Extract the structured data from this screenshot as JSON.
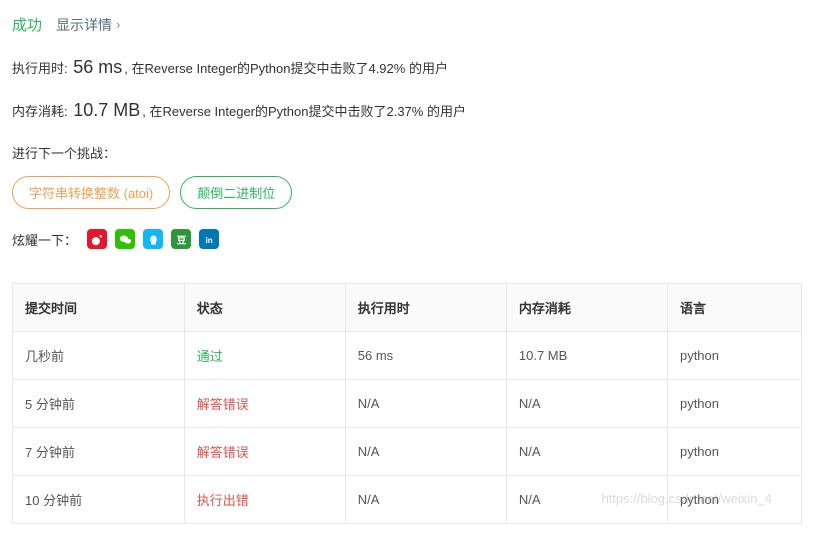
{
  "header": {
    "success": "成功",
    "show_details": "显示详情"
  },
  "runtime": {
    "label": "执行用时:",
    "value": "56 ms",
    "suffix": ", 在Reverse Integer的Python提交中击败了4.92% 的用户"
  },
  "memory": {
    "label": "内存消耗:",
    "value": "10.7 MB",
    "suffix": ", 在Reverse Integer的Python提交中击败了2.37% 的用户"
  },
  "next_challenge_label": "进行下一个挑战：",
  "challenges": {
    "atoi": "字符串转换整数 (atoi)",
    "reverse_bits": "颠倒二进制位"
  },
  "share_label": "炫耀一下：",
  "table": {
    "headers": {
      "time": "提交时间",
      "status": "状态",
      "runtime": "执行用时",
      "memory": "内存消耗",
      "lang": "语言"
    },
    "rows": [
      {
        "time": "几秒前",
        "status": "通过",
        "status_class": "status-pass",
        "runtime": "56 ms",
        "memory": "10.7 MB",
        "lang": "python"
      },
      {
        "time": "5 分钟前",
        "status": "解答错误",
        "status_class": "status-wa",
        "runtime": "N/A",
        "memory": "N/A",
        "lang": "python"
      },
      {
        "time": "7 分钟前",
        "status": "解答错误",
        "status_class": "status-wa",
        "runtime": "N/A",
        "memory": "N/A",
        "lang": "python"
      },
      {
        "time": "10 分钟前",
        "status": "执行出错",
        "status_class": "status-re",
        "runtime": "N/A",
        "memory": "N/A",
        "lang": "python"
      }
    ]
  },
  "watermark": "https://blog.csdn.net/weixin_4"
}
